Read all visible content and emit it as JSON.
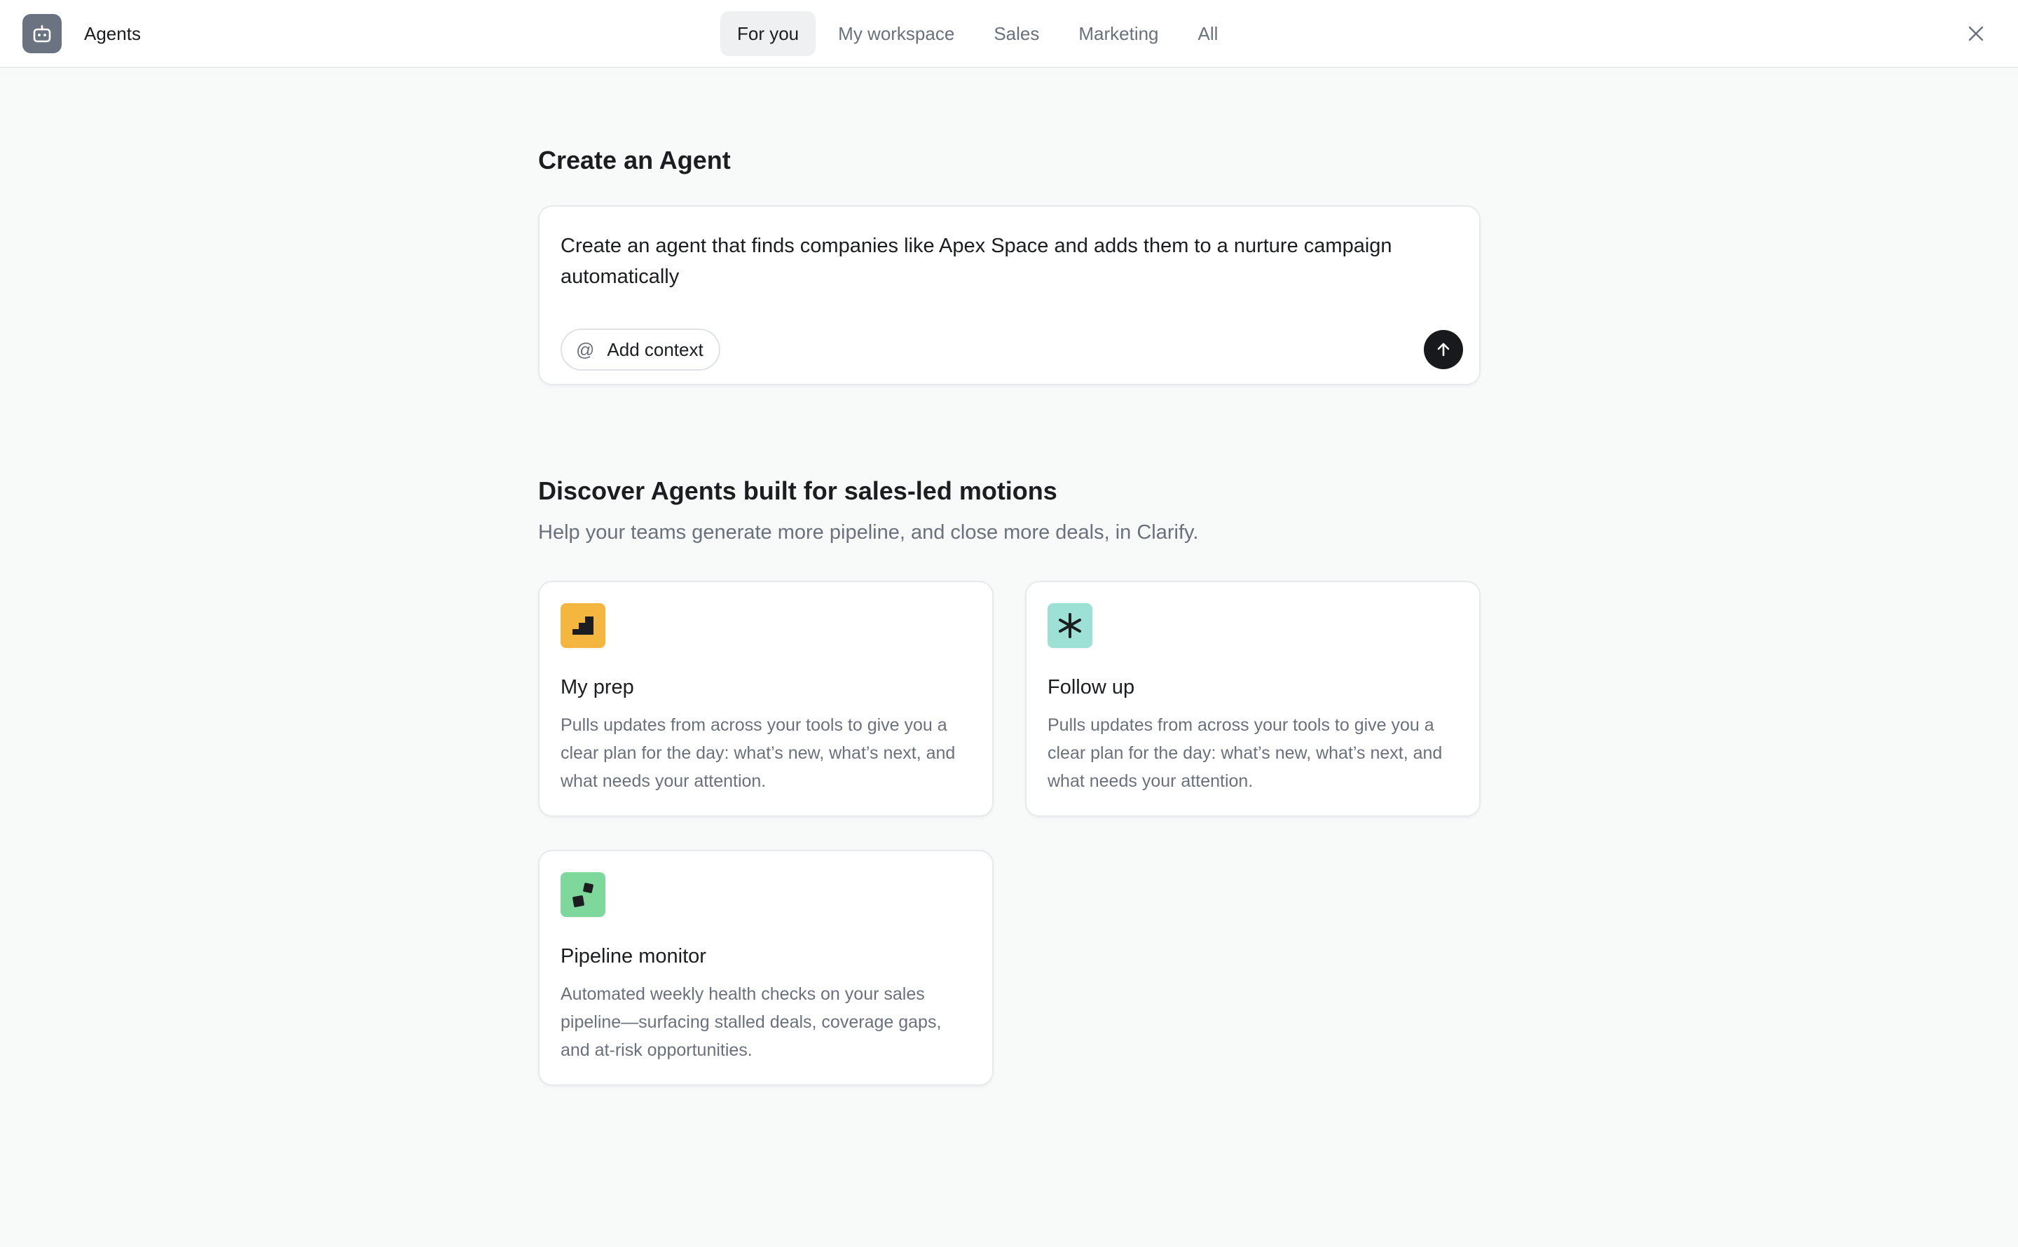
{
  "header": {
    "app_title": "Agents",
    "app_icon": "robot-icon",
    "tabs": [
      {
        "label": "For you",
        "active": true
      },
      {
        "label": "My workspace",
        "active": false
      },
      {
        "label": "Sales",
        "active": false
      },
      {
        "label": "Marketing",
        "active": false
      },
      {
        "label": "All",
        "active": false
      }
    ],
    "close_icon": "close-icon"
  },
  "create": {
    "title": "Create an Agent",
    "prompt_text": "Create an agent that finds companies like Apex Space and adds them to a nurture campaign automatically",
    "add_context_label": "Add context",
    "add_context_icon": "at-sign-icon",
    "send_icon": "arrow-up-icon"
  },
  "discover": {
    "title": "Discover Agents built for sales-led motions",
    "subtitle": "Help your teams generate more pipeline, and close more deals, in Clarify.",
    "cards": [
      {
        "title": "My prep",
        "description": "Pulls updates from across your tools to give you a clear plan for the day: what’s new, what’s next, and what needs your attention.",
        "icon": "stairs-icon",
        "icon_color": "#f4b63f"
      },
      {
        "title": "Follow up",
        "description": "Pulls updates from across your tools to give you a clear plan for the day: what’s new, what’s next, and what needs your attention.",
        "icon": "asterisk-icon",
        "icon_color": "#9de0d5"
      },
      {
        "title": "Pipeline monitor",
        "description": "Automated weekly health checks on your sales pipeline—surfacing stalled deals, coverage gaps, and at-risk opportunities.",
        "icon": "squares-icon",
        "icon_color": "#7ed89c"
      }
    ]
  },
  "colors": {
    "background": "#f8f9f9",
    "surface": "#ffffff",
    "text_primary": "#1b1d21",
    "text_secondary": "#6a717d",
    "active_tab_bg": "#eef0f2",
    "send_button": "#17191d"
  }
}
